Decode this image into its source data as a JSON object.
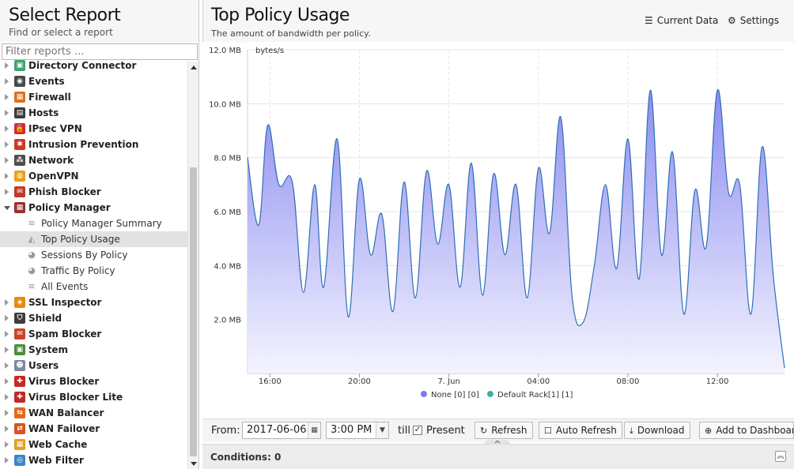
{
  "left_panel": {
    "title": "Select Report",
    "subtitle": "Find or select a report",
    "filter_placeholder": "Filter reports ..."
  },
  "tree": [
    {
      "type": "cat",
      "label": "Directory Connector",
      "icon": "directory-connector-icon",
      "color": "#3aa66b",
      "glyph": "▣",
      "expanded": false
    },
    {
      "type": "cat",
      "label": "Events",
      "icon": "events-icon",
      "color": "#4a4a4a",
      "glyph": "◉",
      "expanded": false
    },
    {
      "type": "cat",
      "label": "Firewall",
      "icon": "firewall-icon",
      "color": "#e0701e",
      "glyph": "▦",
      "expanded": false
    },
    {
      "type": "cat",
      "label": "Hosts",
      "icon": "hosts-icon",
      "color": "#3c3c3c",
      "glyph": "▤",
      "expanded": false
    },
    {
      "type": "cat",
      "label": "IPsec VPN",
      "icon": "ipsec-vpn-icon",
      "color": "#d72b2b",
      "glyph": "🔒",
      "expanded": false
    },
    {
      "type": "cat",
      "label": "Intrusion Prevention",
      "icon": "intrusion-prevention-icon",
      "color": "#cc3a2a",
      "glyph": "✱",
      "expanded": false
    },
    {
      "type": "cat",
      "label": "Network",
      "icon": "network-icon",
      "color": "#4e4e4e",
      "glyph": "⁂",
      "expanded": false
    },
    {
      "type": "cat",
      "label": "OpenVPN",
      "icon": "openvpn-icon",
      "color": "#e5a21b",
      "glyph": "◍",
      "expanded": false
    },
    {
      "type": "cat",
      "label": "Phish Blocker",
      "icon": "phish-blocker-icon",
      "color": "#c0392b",
      "glyph": "✉",
      "expanded": false
    },
    {
      "type": "cat",
      "label": "Policy Manager",
      "icon": "policy-manager-icon",
      "color": "#9a3030",
      "glyph": "▦",
      "expanded": true
    },
    {
      "type": "sub",
      "label": "Policy Manager Summary",
      "icon": "list-icon",
      "glyph": "≡",
      "selected": false
    },
    {
      "type": "sub",
      "label": "Top Policy Usage",
      "icon": "area-chart-icon",
      "glyph": "◭",
      "selected": true
    },
    {
      "type": "sub",
      "label": "Sessions By Policy",
      "icon": "pie-chart-icon",
      "glyph": "◕",
      "selected": false
    },
    {
      "type": "sub",
      "label": "Traffic By Policy",
      "icon": "pie-chart-icon",
      "glyph": "◕",
      "selected": false
    },
    {
      "type": "sub",
      "label": "All Events",
      "icon": "list-icon",
      "glyph": "≡",
      "selected": false
    },
    {
      "type": "cat",
      "label": "SSL Inspector",
      "icon": "ssl-inspector-icon",
      "color": "#e58a14",
      "glyph": "◈",
      "expanded": false
    },
    {
      "type": "cat",
      "label": "Shield",
      "icon": "shield-icon",
      "color": "#3d3d3d",
      "glyph": "⛉",
      "expanded": false
    },
    {
      "type": "cat",
      "label": "Spam Blocker",
      "icon": "spam-blocker-icon",
      "color": "#c9442a",
      "glyph": "✉",
      "expanded": false
    },
    {
      "type": "cat",
      "label": "System",
      "icon": "system-icon",
      "color": "#4f8a3a",
      "glyph": "▣",
      "expanded": false
    },
    {
      "type": "cat",
      "label": "Users",
      "icon": "users-icon",
      "color": "#7d8b99",
      "glyph": "☻",
      "expanded": false
    },
    {
      "type": "cat",
      "label": "Virus Blocker",
      "icon": "virus-blocker-icon",
      "color": "#c62828",
      "glyph": "✚",
      "expanded": false
    },
    {
      "type": "cat",
      "label": "Virus Blocker Lite",
      "icon": "virus-blocker-lite-icon",
      "color": "#c62828",
      "glyph": "✚",
      "expanded": false
    },
    {
      "type": "cat",
      "label": "WAN Balancer",
      "icon": "wan-balancer-icon",
      "color": "#e2681e",
      "glyph": "⇆",
      "expanded": false
    },
    {
      "type": "cat",
      "label": "WAN Failover",
      "icon": "wan-failover-icon",
      "color": "#d9531e",
      "glyph": "⇄",
      "expanded": false
    },
    {
      "type": "cat",
      "label": "Web Cache",
      "icon": "web-cache-icon",
      "color": "#e6a01b",
      "glyph": "▦",
      "expanded": false
    },
    {
      "type": "cat",
      "label": "Web Filter",
      "icon": "web-filter-icon",
      "color": "#3a86c8",
      "glyph": "◎",
      "expanded": false
    }
  ],
  "report": {
    "title": "Top Policy Usage",
    "subtitle": "The amount of bandwidth per policy.",
    "current_data_label": "Current Data",
    "settings_label": "Settings"
  },
  "chart_data": {
    "type": "area",
    "ylabel": "bytes/s",
    "y_ticks": [
      "2.0 MB",
      "4.0 MB",
      "6.0 MB",
      "8.0 MB",
      "10.0 MB",
      "12.0 MB"
    ],
    "y_tick_values": [
      2,
      4,
      6,
      8,
      10,
      12
    ],
    "ylim": [
      0,
      12
    ],
    "y_unit": "MB",
    "x_ticks": [
      "16:00",
      "20:00",
      "7. Jun",
      "04:00",
      "08:00",
      "12:00"
    ],
    "x_tick_hours": [
      16,
      20,
      24,
      28,
      32,
      36
    ],
    "xlim_hours": [
      15,
      39
    ],
    "x_unit_note": "hours from 2017-06-06 00:00",
    "series": [
      {
        "name": "None [0] [0]",
        "color": "#7b7bea",
        "x": [
          15.0,
          15.5,
          15.9,
          16.4,
          17.0,
          17.5,
          18.0,
          18.4,
          19.0,
          19.5,
          20.0,
          20.5,
          21.0,
          21.5,
          22.0,
          22.5,
          23.0,
          23.5,
          24.0,
          24.5,
          25.0,
          25.5,
          26.0,
          26.5,
          27.0,
          27.5,
          28.0,
          28.5,
          29.0,
          29.5,
          30.0,
          30.5,
          31.0,
          31.5,
          32.0,
          32.5,
          33.0,
          33.5,
          34.0,
          34.5,
          35.0,
          35.5,
          36.0,
          36.5,
          37.0,
          37.5,
          38.0,
          38.5,
          39.0
        ],
        "y": [
          8.0,
          5.5,
          9.2,
          7.0,
          7.1,
          3.0,
          7.0,
          3.2,
          8.7,
          2.1,
          7.2,
          4.4,
          5.9,
          2.3,
          7.1,
          2.8,
          7.5,
          4.8,
          7.0,
          3.2,
          7.8,
          2.9,
          7.4,
          4.4,
          7.0,
          2.8,
          7.6,
          5.2,
          9.5,
          2.9,
          1.9,
          4.0,
          7.0,
          3.9,
          8.7,
          3.5,
          10.5,
          4.4,
          8.2,
          2.2,
          6.8,
          4.7,
          10.5,
          6.7,
          7.0,
          2.2,
          8.4,
          3.6,
          0.2
        ]
      },
      {
        "name": "Default Rack[1] [1]",
        "color": "#3ab0a8",
        "x": [],
        "y": []
      }
    ],
    "legend_position": "bottom-center",
    "grid": true
  },
  "toolbar": {
    "from_label": "From:",
    "date_value": "2017-06-06",
    "time_value": "3:00 PM",
    "till_label": "till",
    "present_label": "Present",
    "present_checked": true,
    "refresh_label": "Refresh",
    "auto_refresh_label": "Auto Refresh",
    "download_label": "Download",
    "add_dashboard_label": "Add to Dashboar"
  },
  "conditions": {
    "label": "Conditions: 0"
  }
}
